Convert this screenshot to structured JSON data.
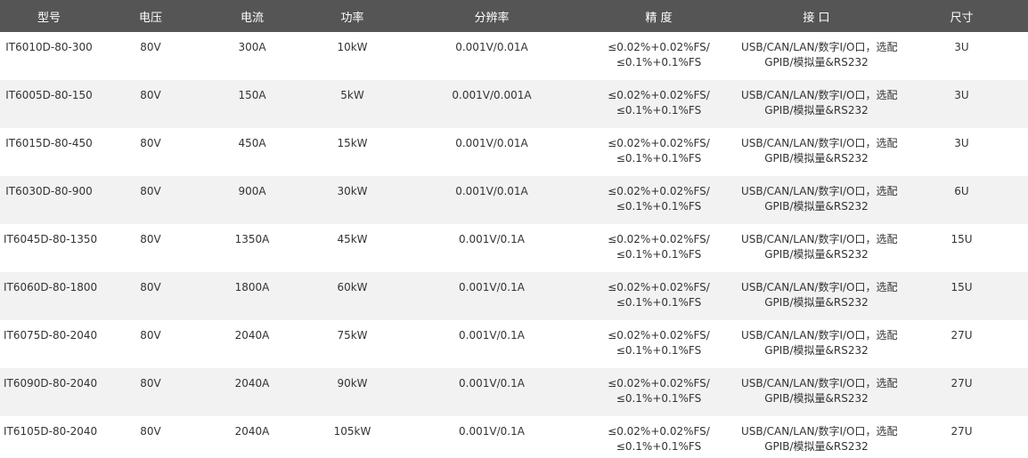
{
  "table": {
    "headers": [
      "型号",
      "电压",
      "电流",
      "功率",
      "分辨率",
      "精 度",
      "接 口",
      "尺寸"
    ],
    "rows": [
      {
        "model": "IT6010D-80-300",
        "voltage": "80V",
        "current": "300A",
        "power": "10kW",
        "resolution": "0.001V/0.01A",
        "accuracy": [
          "≤0.02%+0.02%FS/",
          "≤0.1%+0.1%FS"
        ],
        "interface": [
          "USB/CAN/LAN/数字I/O口，选配",
          "GPIB/模拟量&RS232"
        ],
        "size": "3U"
      },
      {
        "model": "IT6005D-80-150",
        "voltage": "80V",
        "current": "150A",
        "power": "5kW",
        "resolution": "0.001V/0.001A",
        "accuracy": [
          "≤0.02%+0.02%FS/",
          "≤0.1%+0.1%FS"
        ],
        "interface": [
          "USB/CAN/LAN/数字I/O口，选配",
          "GPIB/模拟量&RS232"
        ],
        "size": "3U"
      },
      {
        "model": "IT6015D-80-450",
        "voltage": "80V",
        "current": "450A",
        "power": "15kW",
        "resolution": "0.001V/0.01A",
        "accuracy": [
          "≤0.02%+0.02%FS/",
          "≤0.1%+0.1%FS"
        ],
        "interface": [
          "USB/CAN/LAN/数字I/O口，选配",
          "GPIB/模拟量&RS232"
        ],
        "size": "3U"
      },
      {
        "model": "IT6030D-80-900",
        "voltage": "80V",
        "current": "900A",
        "power": "30kW",
        "resolution": "0.001V/0.01A",
        "accuracy": [
          "≤0.02%+0.02%FS/",
          "≤0.1%+0.1%FS"
        ],
        "interface": [
          "USB/CAN/LAN/数字I/O口，选配",
          "GPIB/模拟量&RS232"
        ],
        "size": "6U"
      },
      {
        "model": "IT6045D-80-1350",
        "voltage": "80V",
        "current": "1350A",
        "power": "45kW",
        "resolution": "0.001V/0.1A",
        "accuracy": [
          "≤0.02%+0.02%FS/",
          "≤0.1%+0.1%FS"
        ],
        "interface": [
          "USB/CAN/LAN/数字I/O口，选配",
          "GPIB/模拟量&RS232"
        ],
        "size": "15U"
      },
      {
        "model": "IT6060D-80-1800",
        "voltage": "80V",
        "current": "1800A",
        "power": "60kW",
        "resolution": "0.001V/0.1A",
        "accuracy": [
          "≤0.02%+0.02%FS/",
          "≤0.1%+0.1%FS"
        ],
        "interface": [
          "USB/CAN/LAN/数字I/O口，选配",
          "GPIB/模拟量&RS232"
        ],
        "size": "15U"
      },
      {
        "model": "IT6075D-80-2040",
        "voltage": "80V",
        "current": "2040A",
        "power": "75kW",
        "resolution": "0.001V/0.1A",
        "accuracy": [
          "≤0.02%+0.02%FS/",
          "≤0.1%+0.1%FS"
        ],
        "interface": [
          "USB/CAN/LAN/数字I/O口，选配",
          "GPIB/模拟量&RS232"
        ],
        "size": "27U"
      },
      {
        "model": "IT6090D-80-2040",
        "voltage": "80V",
        "current": "2040A",
        "power": "90kW",
        "resolution": "0.001V/0.1A",
        "accuracy": [
          "≤0.02%+0.02%FS/",
          "≤0.1%+0.1%FS"
        ],
        "interface": [
          "USB/CAN/LAN/数字I/O口，选配",
          "GPIB/模拟量&RS232"
        ],
        "size": "27U"
      },
      {
        "model": "IT6105D-80-2040",
        "voltage": "80V",
        "current": "2040A",
        "power": "105kW",
        "resolution": "0.001V/0.1A",
        "accuracy": [
          "≤0.02%+0.02%FS/",
          "≤0.1%+0.1%FS"
        ],
        "interface": [
          "USB/CAN/LAN/数字I/O口，选配",
          "GPIB/模拟量&RS232"
        ],
        "size": "27U"
      }
    ]
  }
}
